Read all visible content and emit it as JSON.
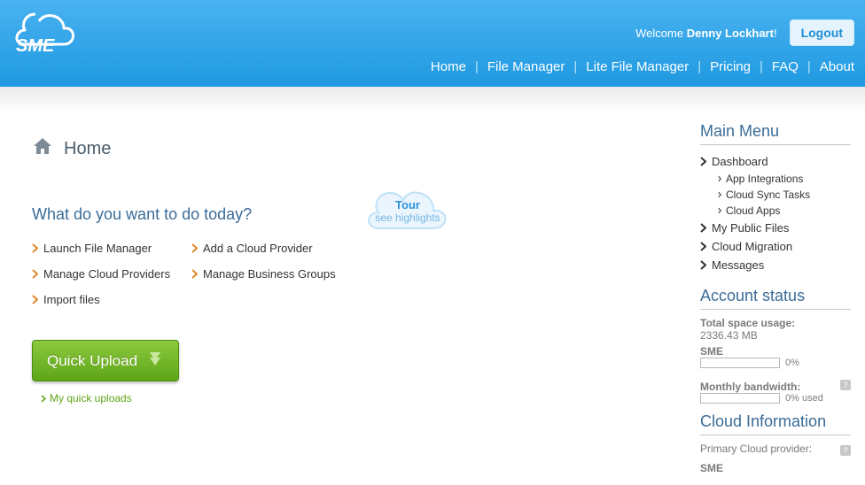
{
  "header": {
    "welcome_prefix": "Welcome ",
    "username": "Denny Lockhart",
    "welcome_suffix": "!",
    "logout": "Logout",
    "nav": [
      "Home",
      "File Manager",
      "Lite File Manager",
      "Pricing",
      "FAQ",
      "About"
    ]
  },
  "page": {
    "title": "Home",
    "tour_title": "Tour",
    "tour_sub": "see highlights",
    "question": "What do you want to do today?",
    "tasks_col1": [
      "Launch File Manager",
      "Manage Cloud Providers",
      "Import files"
    ],
    "tasks_col2": [
      "Add a Cloud Provider",
      "Manage Business Groups"
    ],
    "quick_upload": "Quick Upload",
    "my_uploads": "My quick uploads"
  },
  "sidebar": {
    "main_menu_title": "Main Menu",
    "menu": {
      "dashboard": "Dashboard",
      "dashboard_sub": [
        "App Integrations",
        "Cloud Sync Tasks",
        "Cloud Apps"
      ],
      "public_files": "My Public Files",
      "cloud_migration": "Cloud Migration",
      "messages": "Messages"
    },
    "account": {
      "title": "Account status",
      "total_label": "Total space usage:",
      "total_value": "2336.43 MB",
      "sme_label": "SME",
      "sme_pct": "0%",
      "bw_label": "Monthly bandwidth:",
      "bw_pct": "0% used"
    },
    "cloud": {
      "title": "Cloud Information",
      "primary_label": "Primary Cloud provider:",
      "primary_value": "SME"
    }
  }
}
